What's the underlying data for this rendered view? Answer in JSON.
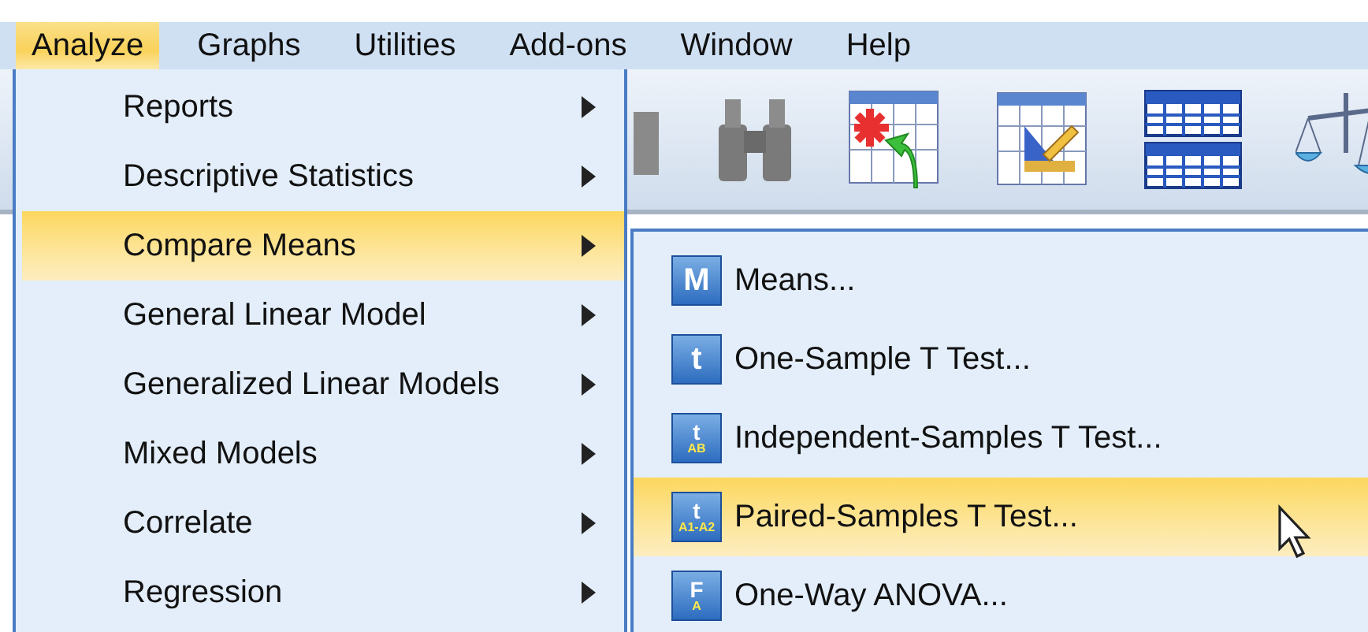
{
  "menu_bar": [
    {
      "label": "Analyze",
      "selected": true
    },
    {
      "label": "Graphs",
      "selected": false
    },
    {
      "label": "Utilities",
      "selected": false
    },
    {
      "label": "Add-ons",
      "selected": false
    },
    {
      "label": "Window",
      "selected": false
    },
    {
      "label": "Help",
      "selected": false
    }
  ],
  "analyze_menu": [
    {
      "label": "Reports",
      "has_submenu": true,
      "selected": false
    },
    {
      "label": "Descriptive Statistics",
      "has_submenu": true,
      "selected": false
    },
    {
      "label": "Compare Means",
      "has_submenu": true,
      "selected": true
    },
    {
      "label": "General Linear Model",
      "has_submenu": true,
      "selected": false
    },
    {
      "label": "Generalized Linear Models",
      "has_submenu": true,
      "selected": false
    },
    {
      "label": "Mixed Models",
      "has_submenu": true,
      "selected": false
    },
    {
      "label": "Correlate",
      "has_submenu": true,
      "selected": false
    },
    {
      "label": "Regression",
      "has_submenu": true,
      "selected": false
    }
  ],
  "compare_means_menu": [
    {
      "label": "Means...",
      "icon": {
        "glyph": "M"
      },
      "selected": false
    },
    {
      "label": "One-Sample T Test...",
      "icon": {
        "glyph": "t"
      },
      "selected": false
    },
    {
      "label": "Independent-Samples T Test...",
      "icon": {
        "glyph": "t",
        "sub": "AB"
      },
      "selected": false
    },
    {
      "label": "Paired-Samples T Test...",
      "icon": {
        "glyph": "t",
        "sub": "A1-A2"
      },
      "selected": true
    },
    {
      "label": "One-Way ANOVA...",
      "icon": {
        "glyph": "F",
        "sub": "A"
      },
      "selected": false
    }
  ]
}
